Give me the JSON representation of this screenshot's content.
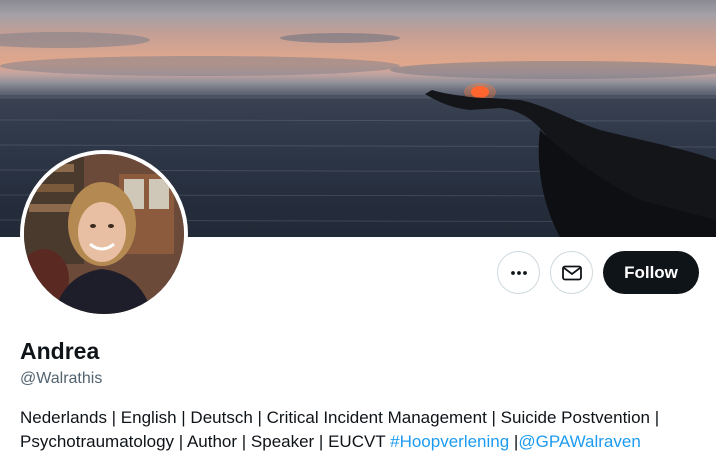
{
  "profile": {
    "display_name": "Andrea",
    "handle": "@Walrathis",
    "bio_line1": "Nederlands | English | Deutsch | Critical Incident Management | Suicide Postvention |",
    "bio_line2_text": "Psychotraumatology | Author | Speaker | EUCVT ",
    "bio_hashtag": "#Hoopverlening",
    "bio_separator": " |",
    "bio_mention": "@GPAWalraven"
  },
  "actions": {
    "more_icon": "more-horizontal-icon",
    "message_icon": "envelope-icon",
    "follow_label": "Follow"
  },
  "colors": {
    "link": "#1d9bf0",
    "follow_bg": "#0f1419",
    "secondary_text": "#536471"
  }
}
